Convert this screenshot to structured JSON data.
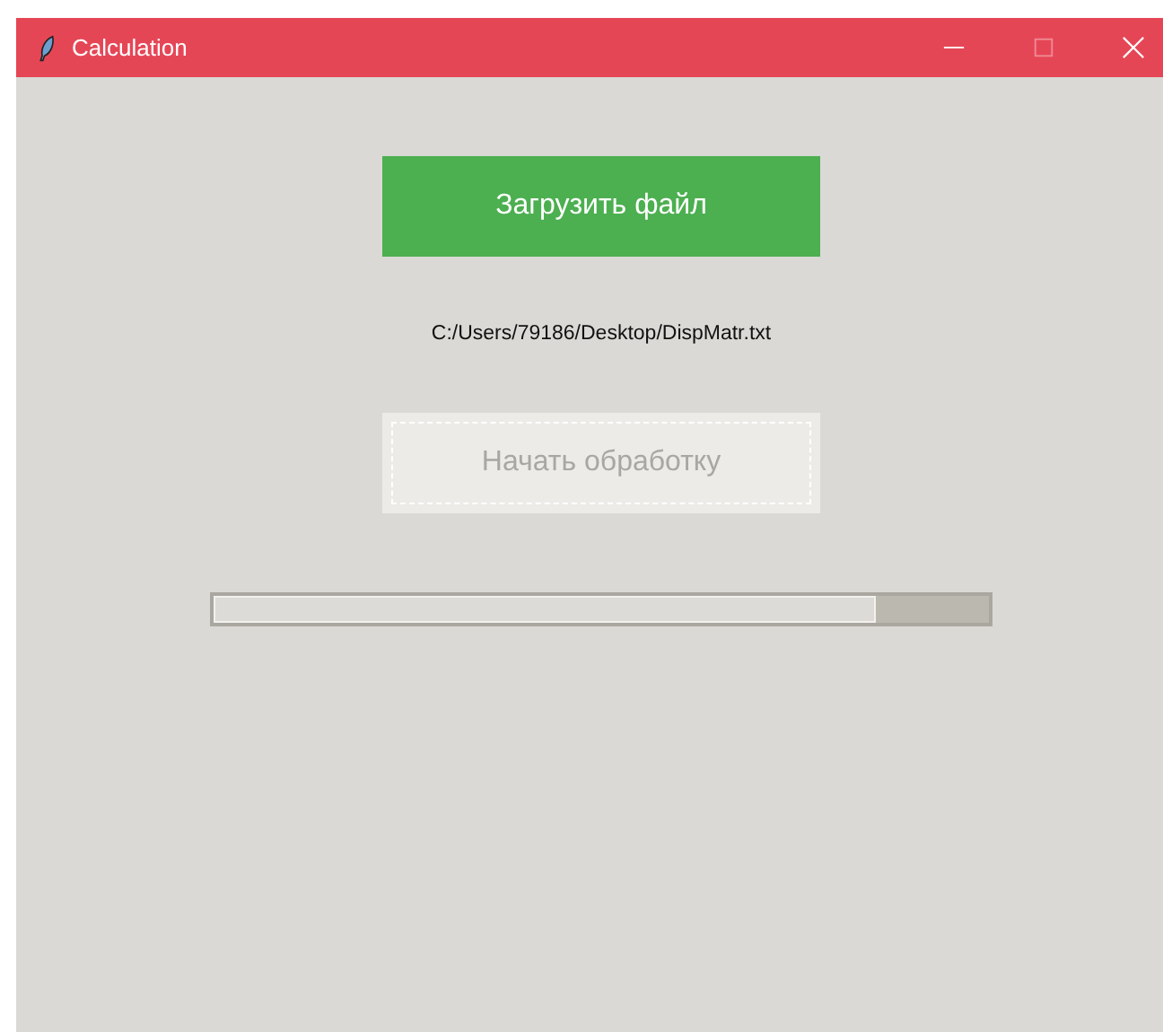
{
  "window": {
    "title": "Calculation"
  },
  "load_button": {
    "label": "Загрузить файл",
    "disabled": false
  },
  "file_path": "C:/Users/79186/Desktop/DispMatr.txt",
  "start_button": {
    "label": "Начать обработку",
    "disabled": true
  },
  "progress": {
    "level": 0.855
  }
}
